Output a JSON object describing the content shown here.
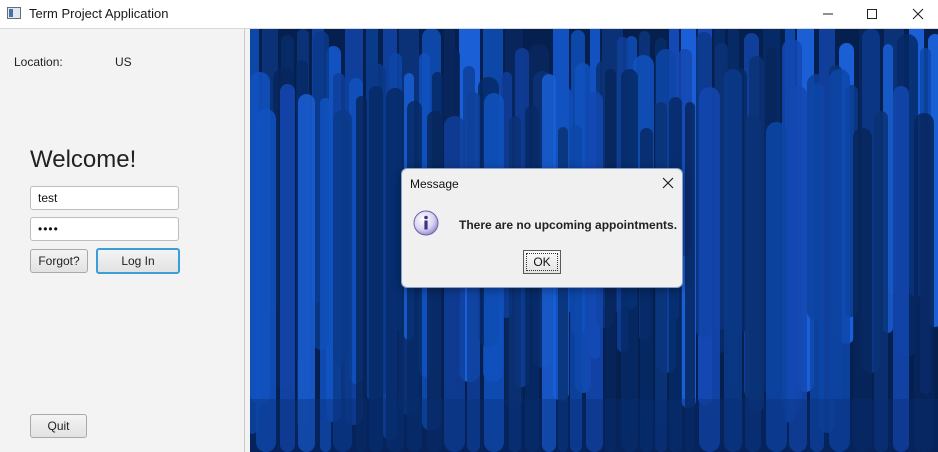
{
  "window": {
    "title": "Term Project Application",
    "icon": "app-window-icon",
    "controls": [
      "minimize-icon",
      "maximize-icon",
      "close-icon"
    ]
  },
  "login": {
    "location_label": "Location:",
    "location_value": "US",
    "welcome": "Welcome!",
    "username_value": "test",
    "password_value": "••••",
    "forgot_label": "Forgot?",
    "login_label": "Log In",
    "quit_label": "Quit"
  },
  "dialog": {
    "title": "Message",
    "message": "There are no upcoming appointments.",
    "ok_label": "OK",
    "icon": "info-icon"
  },
  "colors": {
    "background_art_dark": "#05204f",
    "background_art_bright": "#1a5fd6",
    "focus_accent": "#3c9ed8"
  }
}
